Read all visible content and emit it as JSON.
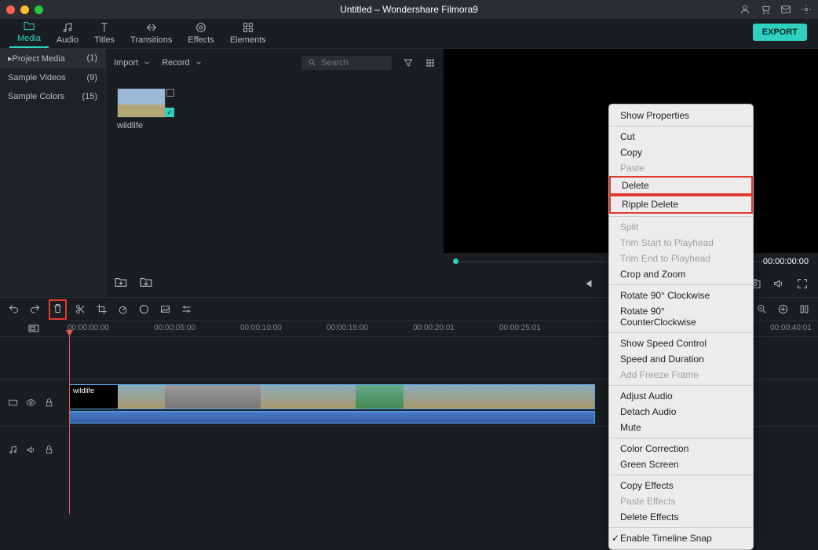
{
  "titlebar": {
    "title": "Untitled – Wondershare Filmora9"
  },
  "topnav": {
    "items": [
      {
        "label": "Media"
      },
      {
        "label": "Audio"
      },
      {
        "label": "Titles"
      },
      {
        "label": "Transitions"
      },
      {
        "label": "Effects"
      },
      {
        "label": "Elements"
      }
    ],
    "export_label": "EXPORT"
  },
  "sidebar": {
    "items": [
      {
        "label": "Project Media",
        "count": "(1)"
      },
      {
        "label": "Sample Videos",
        "count": "(9)"
      },
      {
        "label": "Sample Colors",
        "count": "(15)"
      }
    ]
  },
  "mediabar": {
    "import_label": "Import",
    "record_label": "Record",
    "search_placeholder": "Search"
  },
  "clip": {
    "label": "wildlife"
  },
  "preview": {
    "timecode": "00:00:00:00"
  },
  "ruler": {
    "marks": [
      "00:00:00:00",
      "00:00:05:00",
      "00:00:10:00",
      "00:00:15:00",
      "00:00:20:01",
      "00:00:25:01",
      "",
      "00:00:40:01"
    ]
  },
  "video_track": {
    "clip_label": "wildlife"
  },
  "ctxmenu": {
    "items": [
      {
        "label": "Show Properties"
      },
      {
        "sep": true
      },
      {
        "label": "Cut"
      },
      {
        "label": "Copy"
      },
      {
        "label": "Paste",
        "disabled": true
      },
      {
        "label": "Delete",
        "hl": true
      },
      {
        "label": "Ripple Delete",
        "hl": true
      },
      {
        "sep": true
      },
      {
        "label": "Split",
        "disabled": true
      },
      {
        "label": "Trim Start to Playhead",
        "disabled": true
      },
      {
        "label": "Trim End to Playhead",
        "disabled": true
      },
      {
        "label": "Crop and Zoom"
      },
      {
        "sep": true
      },
      {
        "label": "Rotate 90° Clockwise"
      },
      {
        "label": "Rotate 90° CounterClockwise"
      },
      {
        "sep": true
      },
      {
        "label": "Show Speed Control"
      },
      {
        "label": "Speed and Duration"
      },
      {
        "label": "Add Freeze Frame",
        "disabled": true
      },
      {
        "sep": true
      },
      {
        "label": "Adjust Audio"
      },
      {
        "label": "Detach Audio"
      },
      {
        "label": "Mute"
      },
      {
        "sep": true
      },
      {
        "label": "Color Correction"
      },
      {
        "label": "Green Screen"
      },
      {
        "sep": true
      },
      {
        "label": "Copy Effects"
      },
      {
        "label": "Paste Effects",
        "disabled": true
      },
      {
        "label": "Delete Effects"
      },
      {
        "sep": true
      },
      {
        "label": "Enable Timeline Snap",
        "checked": true
      }
    ]
  }
}
